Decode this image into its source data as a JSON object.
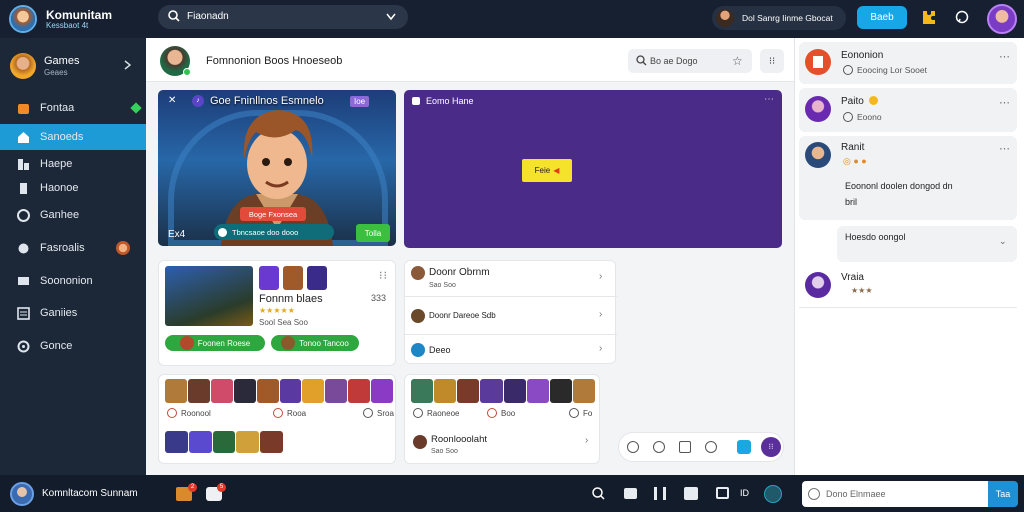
{
  "top": {
    "app_name": "Komunitam",
    "app_subtitle": "Kessbaot 4t",
    "search_value": "Fiaonadn",
    "profile_name": "Dol Sanrg Iinme Gbocat",
    "primary_button": "Baeb"
  },
  "sidebar": {
    "profile_label": "Games",
    "profile_sub": "Geaes",
    "items": [
      {
        "label": "Fontaa",
        "icon": "fire-icon"
      },
      {
        "label": "Sanoeds",
        "icon": "home-icon"
      },
      {
        "label": "Haepe",
        "icon": "grid-icon"
      },
      {
        "label": "Haonoe",
        "icon": "bar-icon"
      },
      {
        "label": "Ganhee",
        "icon": "gamepad-icon"
      },
      {
        "label": "Fasroalis",
        "icon": "trophy-icon"
      },
      {
        "label": "Soononion",
        "icon": "chat-icon"
      },
      {
        "label": "Ganiies",
        "icon": "list-icon"
      },
      {
        "label": "Gonce",
        "icon": "settings-icon"
      }
    ]
  },
  "header": {
    "title": "Fomnonion Boos Hnoeseob",
    "search_placeholder": "Bo ae Dogo"
  },
  "hero": {
    "title": "Goe Fninllnos Esmnelo",
    "badge": "Ioe",
    "red_button": "Boge Fxonsea",
    "label": "Ex4",
    "teal_button": "Tbncsaoe doo dooo",
    "green_button": "Tolla"
  },
  "panel": {
    "title": "Eomo Hane",
    "center_button": "Feie"
  },
  "cards": {
    "game_title": "Fonnm blaes",
    "game_sub": "Sool Sea Soo",
    "game_count": "333",
    "tag1": "Foonen Roese",
    "tag2": "Tonoo Tancoo",
    "rating": "★★★★★",
    "list_items": [
      {
        "label": "Doonr Obrnm",
        "sub": "Sao Soo"
      },
      {
        "label": "Doonr Dareoe Sdb",
        "sub": ""
      },
      {
        "label": "Deeo",
        "sub": ""
      }
    ],
    "grid_labels_left": [
      "Roonool",
      "Rooa",
      "Sroa"
    ],
    "grid_labels_right": [
      "Raoneoe",
      "Boo",
      "Fo"
    ],
    "bottom_right_title": "Roonlooolaht",
    "bottom_right_sub": "Sao Soo"
  },
  "right": {
    "items": [
      {
        "name": "Eononion",
        "text": "Eoocing Lor Sooet",
        "sub": ""
      },
      {
        "name": "Paito",
        "text": "Eoono",
        "sub": ""
      },
      {
        "name": "Ranit",
        "text": "Eoononl doolen dongod dn",
        "sub": "bril"
      },
      {
        "name": "Hoesdo oongol",
        "text": "",
        "sub": ""
      },
      {
        "name": "Vraia",
        "text": "★★★",
        "sub": ""
      }
    ]
  },
  "bottom": {
    "user": "Komnltacom Sunnam",
    "badge1": "2",
    "badge2": "5",
    "text_id": "ID",
    "message_placeholder": "Dono Elnmaee",
    "send_button": "Taa"
  }
}
